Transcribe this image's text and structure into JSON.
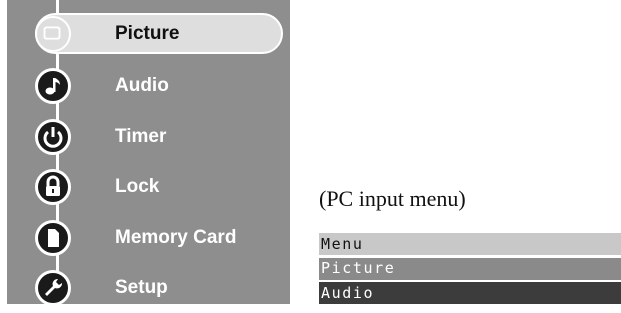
{
  "tv_menu": {
    "items": [
      {
        "label": "Picture",
        "icon": "picture-icon",
        "selected": true
      },
      {
        "label": "Audio",
        "icon": "music-note-icon",
        "selected": false
      },
      {
        "label": "Timer",
        "icon": "power-icon",
        "selected": false
      },
      {
        "label": "Lock",
        "icon": "padlock-icon",
        "selected": false
      },
      {
        "label": "Memory Card",
        "icon": "memory-card-icon",
        "selected": false
      },
      {
        "label": "Setup",
        "icon": "wrench-icon",
        "selected": false
      }
    ],
    "colors": {
      "background": "#8e8e8e",
      "selected_pill": "#dedede",
      "icon_fill": "#1a1a1a"
    }
  },
  "pc_menu": {
    "caption": "(PC input menu)",
    "title": "Menu",
    "items": [
      {
        "label": "Picture",
        "selected": true
      },
      {
        "label": "Audio",
        "selected": false
      }
    ],
    "colors": {
      "title_bg": "#c8c8c8",
      "selected_bg": "#8a8a8a",
      "normal_bg": "#3c3c3c"
    }
  }
}
